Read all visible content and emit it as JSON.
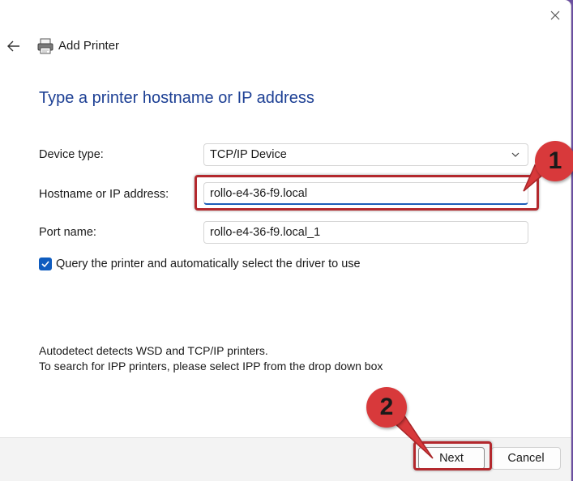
{
  "window": {
    "title": "Add Printer",
    "heading": "Type a printer hostname or IP address"
  },
  "form": {
    "device_type_label": "Device type:",
    "device_type_value": "TCP/IP Device",
    "hostname_label": "Hostname or IP address:",
    "hostname_value": "rollo-e4-36-f9.local",
    "port_label": "Port name:",
    "port_value": "rollo-e4-36-f9.local_1",
    "query_checkbox_label": "Query the printer and automatically select the driver to use",
    "query_checked": true
  },
  "info": {
    "line1": "Autodetect detects WSD and TCP/IP printers.",
    "line2": "To search for IPP printers, please select IPP from the drop down box"
  },
  "footer": {
    "next_label": "Next",
    "cancel_label": "Cancel"
  },
  "annotations": {
    "step1": "1",
    "step2": "2",
    "color": "#d8393b"
  },
  "icons": {
    "close": "close-icon",
    "back": "back-arrow-icon",
    "printer": "printer-icon",
    "chevron": "chevron-down-icon",
    "check": "checkmark-icon"
  }
}
